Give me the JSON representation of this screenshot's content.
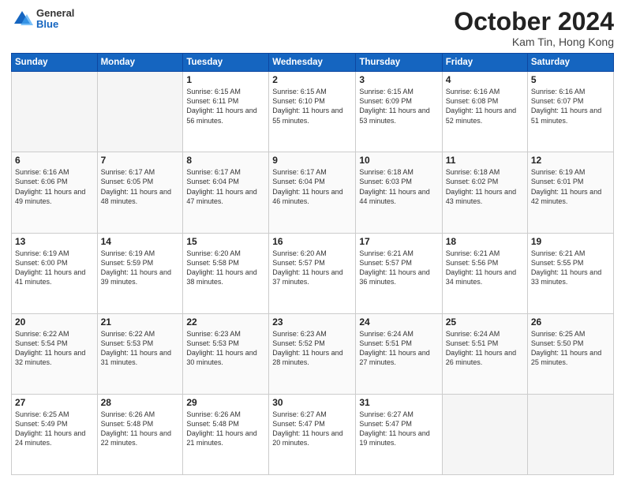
{
  "header": {
    "logo_general": "General",
    "logo_blue": "Blue",
    "month": "October 2024",
    "location": "Kam Tin, Hong Kong"
  },
  "weekdays": [
    "Sunday",
    "Monday",
    "Tuesday",
    "Wednesday",
    "Thursday",
    "Friday",
    "Saturday"
  ],
  "weeks": [
    [
      {
        "day": "",
        "info": ""
      },
      {
        "day": "",
        "info": ""
      },
      {
        "day": "1",
        "info": "Sunrise: 6:15 AM\nSunset: 6:11 PM\nDaylight: 11 hours and 56 minutes."
      },
      {
        "day": "2",
        "info": "Sunrise: 6:15 AM\nSunset: 6:10 PM\nDaylight: 11 hours and 55 minutes."
      },
      {
        "day": "3",
        "info": "Sunrise: 6:15 AM\nSunset: 6:09 PM\nDaylight: 11 hours and 53 minutes."
      },
      {
        "day": "4",
        "info": "Sunrise: 6:16 AM\nSunset: 6:08 PM\nDaylight: 11 hours and 52 minutes."
      },
      {
        "day": "5",
        "info": "Sunrise: 6:16 AM\nSunset: 6:07 PM\nDaylight: 11 hours and 51 minutes."
      }
    ],
    [
      {
        "day": "6",
        "info": "Sunrise: 6:16 AM\nSunset: 6:06 PM\nDaylight: 11 hours and 49 minutes."
      },
      {
        "day": "7",
        "info": "Sunrise: 6:17 AM\nSunset: 6:05 PM\nDaylight: 11 hours and 48 minutes."
      },
      {
        "day": "8",
        "info": "Sunrise: 6:17 AM\nSunset: 6:04 PM\nDaylight: 11 hours and 47 minutes."
      },
      {
        "day": "9",
        "info": "Sunrise: 6:17 AM\nSunset: 6:04 PM\nDaylight: 11 hours and 46 minutes."
      },
      {
        "day": "10",
        "info": "Sunrise: 6:18 AM\nSunset: 6:03 PM\nDaylight: 11 hours and 44 minutes."
      },
      {
        "day": "11",
        "info": "Sunrise: 6:18 AM\nSunset: 6:02 PM\nDaylight: 11 hours and 43 minutes."
      },
      {
        "day": "12",
        "info": "Sunrise: 6:19 AM\nSunset: 6:01 PM\nDaylight: 11 hours and 42 minutes."
      }
    ],
    [
      {
        "day": "13",
        "info": "Sunrise: 6:19 AM\nSunset: 6:00 PM\nDaylight: 11 hours and 41 minutes."
      },
      {
        "day": "14",
        "info": "Sunrise: 6:19 AM\nSunset: 5:59 PM\nDaylight: 11 hours and 39 minutes."
      },
      {
        "day": "15",
        "info": "Sunrise: 6:20 AM\nSunset: 5:58 PM\nDaylight: 11 hours and 38 minutes."
      },
      {
        "day": "16",
        "info": "Sunrise: 6:20 AM\nSunset: 5:57 PM\nDaylight: 11 hours and 37 minutes."
      },
      {
        "day": "17",
        "info": "Sunrise: 6:21 AM\nSunset: 5:57 PM\nDaylight: 11 hours and 36 minutes."
      },
      {
        "day": "18",
        "info": "Sunrise: 6:21 AM\nSunset: 5:56 PM\nDaylight: 11 hours and 34 minutes."
      },
      {
        "day": "19",
        "info": "Sunrise: 6:21 AM\nSunset: 5:55 PM\nDaylight: 11 hours and 33 minutes."
      }
    ],
    [
      {
        "day": "20",
        "info": "Sunrise: 6:22 AM\nSunset: 5:54 PM\nDaylight: 11 hours and 32 minutes."
      },
      {
        "day": "21",
        "info": "Sunrise: 6:22 AM\nSunset: 5:53 PM\nDaylight: 11 hours and 31 minutes."
      },
      {
        "day": "22",
        "info": "Sunrise: 6:23 AM\nSunset: 5:53 PM\nDaylight: 11 hours and 30 minutes."
      },
      {
        "day": "23",
        "info": "Sunrise: 6:23 AM\nSunset: 5:52 PM\nDaylight: 11 hours and 28 minutes."
      },
      {
        "day": "24",
        "info": "Sunrise: 6:24 AM\nSunset: 5:51 PM\nDaylight: 11 hours and 27 minutes."
      },
      {
        "day": "25",
        "info": "Sunrise: 6:24 AM\nSunset: 5:51 PM\nDaylight: 11 hours and 26 minutes."
      },
      {
        "day": "26",
        "info": "Sunrise: 6:25 AM\nSunset: 5:50 PM\nDaylight: 11 hours and 25 minutes."
      }
    ],
    [
      {
        "day": "27",
        "info": "Sunrise: 6:25 AM\nSunset: 5:49 PM\nDaylight: 11 hours and 24 minutes."
      },
      {
        "day": "28",
        "info": "Sunrise: 6:26 AM\nSunset: 5:48 PM\nDaylight: 11 hours and 22 minutes."
      },
      {
        "day": "29",
        "info": "Sunrise: 6:26 AM\nSunset: 5:48 PM\nDaylight: 11 hours and 21 minutes."
      },
      {
        "day": "30",
        "info": "Sunrise: 6:27 AM\nSunset: 5:47 PM\nDaylight: 11 hours and 20 minutes."
      },
      {
        "day": "31",
        "info": "Sunrise: 6:27 AM\nSunset: 5:47 PM\nDaylight: 11 hours and 19 minutes."
      },
      {
        "day": "",
        "info": ""
      },
      {
        "day": "",
        "info": ""
      }
    ]
  ]
}
